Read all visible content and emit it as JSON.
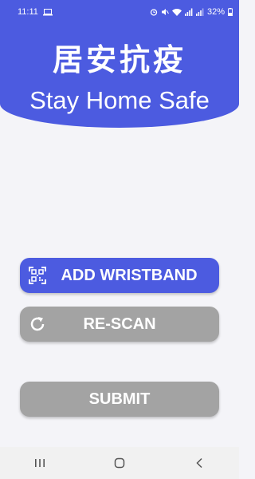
{
  "status_bar": {
    "time": "11:11",
    "battery": "32%"
  },
  "header": {
    "title_cn": "居安抗疫",
    "title_en": "Stay Home Safe"
  },
  "buttons": {
    "add_wristband": "ADD WRISTBAND",
    "rescan": "RE-SCAN",
    "submit": "SUBMIT"
  },
  "icons": {
    "add_wristband": "qr-code-scan-icon",
    "rescan": "refresh-icon",
    "nav_recents": "recent-apps-icon",
    "nav_home": "home-icon",
    "nav_back": "back-icon"
  },
  "colors": {
    "primary": "#4c5be0",
    "disabled": "#a3a3a3",
    "background": "#f4f4f8"
  }
}
